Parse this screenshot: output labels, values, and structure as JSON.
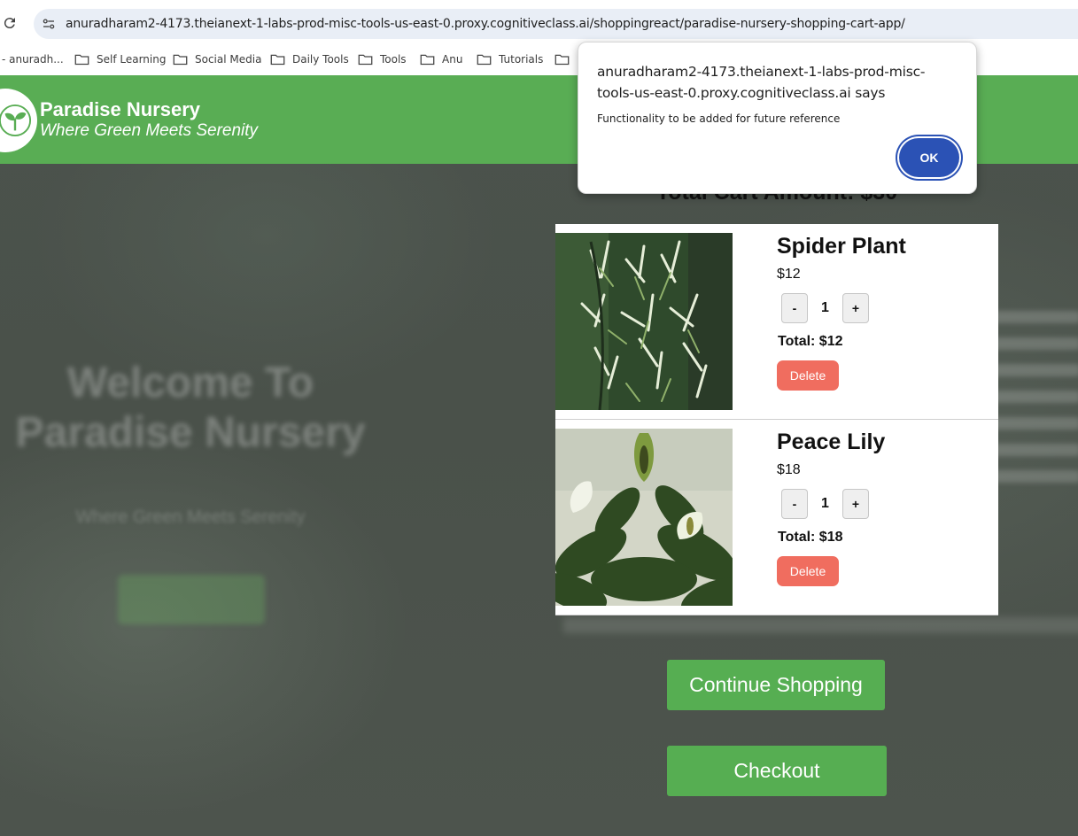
{
  "browser": {
    "url": "anuradharam2-4173.theianext-1-labs-prod-misc-tools-us-east-0.proxy.cognitiveclass.ai/shoppingreact/paradise-nursery-shopping-cart-app/",
    "bookmarks": [
      "- anuradh...",
      "Self Learning",
      "Social Media",
      "Daily Tools",
      "Tools",
      "Anu",
      "Tutorials",
      ""
    ]
  },
  "navbar": {
    "brand_name": "Paradise Nursery",
    "tagline": "Where Green Meets Serenity"
  },
  "background": {
    "welcome": "Welcome To Paradise Nursery",
    "subtitle": "Where Green Meets Serenity"
  },
  "cart": {
    "total_label": "Total Cart Amount: $30",
    "items": [
      {
        "name": "Spider Plant",
        "price": "$12",
        "minus": "-",
        "quantity": "1",
        "plus": "+",
        "total": "Total: $12",
        "delete": "Delete"
      },
      {
        "name": "Peace Lily",
        "price": "$18",
        "minus": "-",
        "quantity": "1",
        "plus": "+",
        "total": "Total: $18",
        "delete": "Delete"
      }
    ],
    "continue_label": "Continue Shopping",
    "checkout_label": "Checkout"
  },
  "dialog": {
    "title": "anuradharam2-4173.theianext-1-labs-prod-misc-tools-us-east-0.proxy.cognitiveclass.ai says",
    "message": "Functionality to be added for future reference",
    "ok_label": "OK"
  },
  "colors": {
    "brand_green": "#59ad54",
    "delete_red": "#f06d5f",
    "dialog_blue": "#2b52b5"
  }
}
